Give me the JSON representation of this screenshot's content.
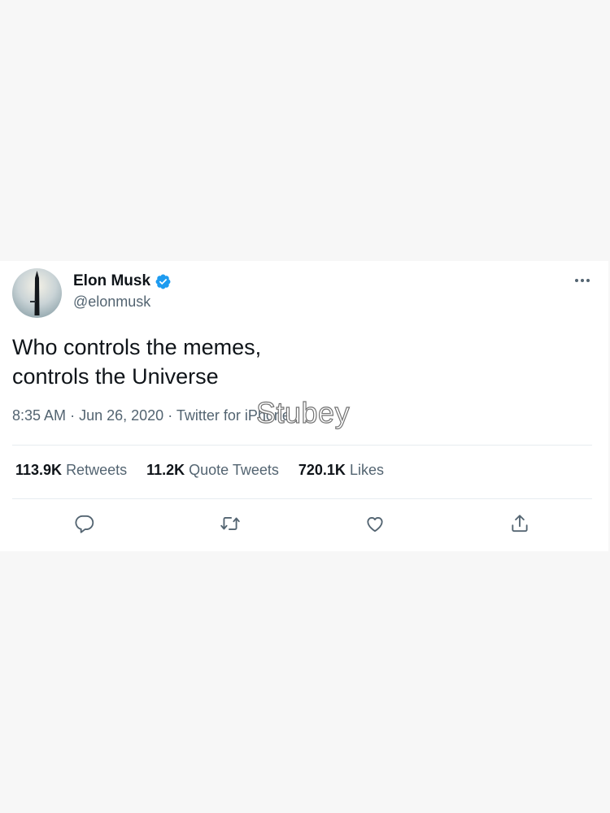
{
  "tweet": {
    "author": {
      "display_name": "Elon Musk",
      "handle": "@elonmusk",
      "verified": true
    },
    "text": "Who controls the memes,\ncontrols the Universe",
    "time": "8:35 AM",
    "date": "Jun 26, 2020",
    "source": "Twitter for iPhone",
    "meta_separator": "·",
    "stats": [
      {
        "count": "113.9K",
        "label": "Retweets"
      },
      {
        "count": "11.2K",
        "label": "Quote Tweets"
      },
      {
        "count": "720.1K",
        "label": "Likes"
      }
    ],
    "actions": [
      "reply-icon",
      "retweet-icon",
      "like-icon",
      "share-icon"
    ]
  },
  "watermark": "Stubey",
  "colors": {
    "page_background": "#f7f7f7",
    "card_background": "#ffffff",
    "text_primary": "#0f1419",
    "text_secondary": "#536471",
    "verified_blue": "#1d9bf0",
    "divider": "#e6ecf0"
  }
}
